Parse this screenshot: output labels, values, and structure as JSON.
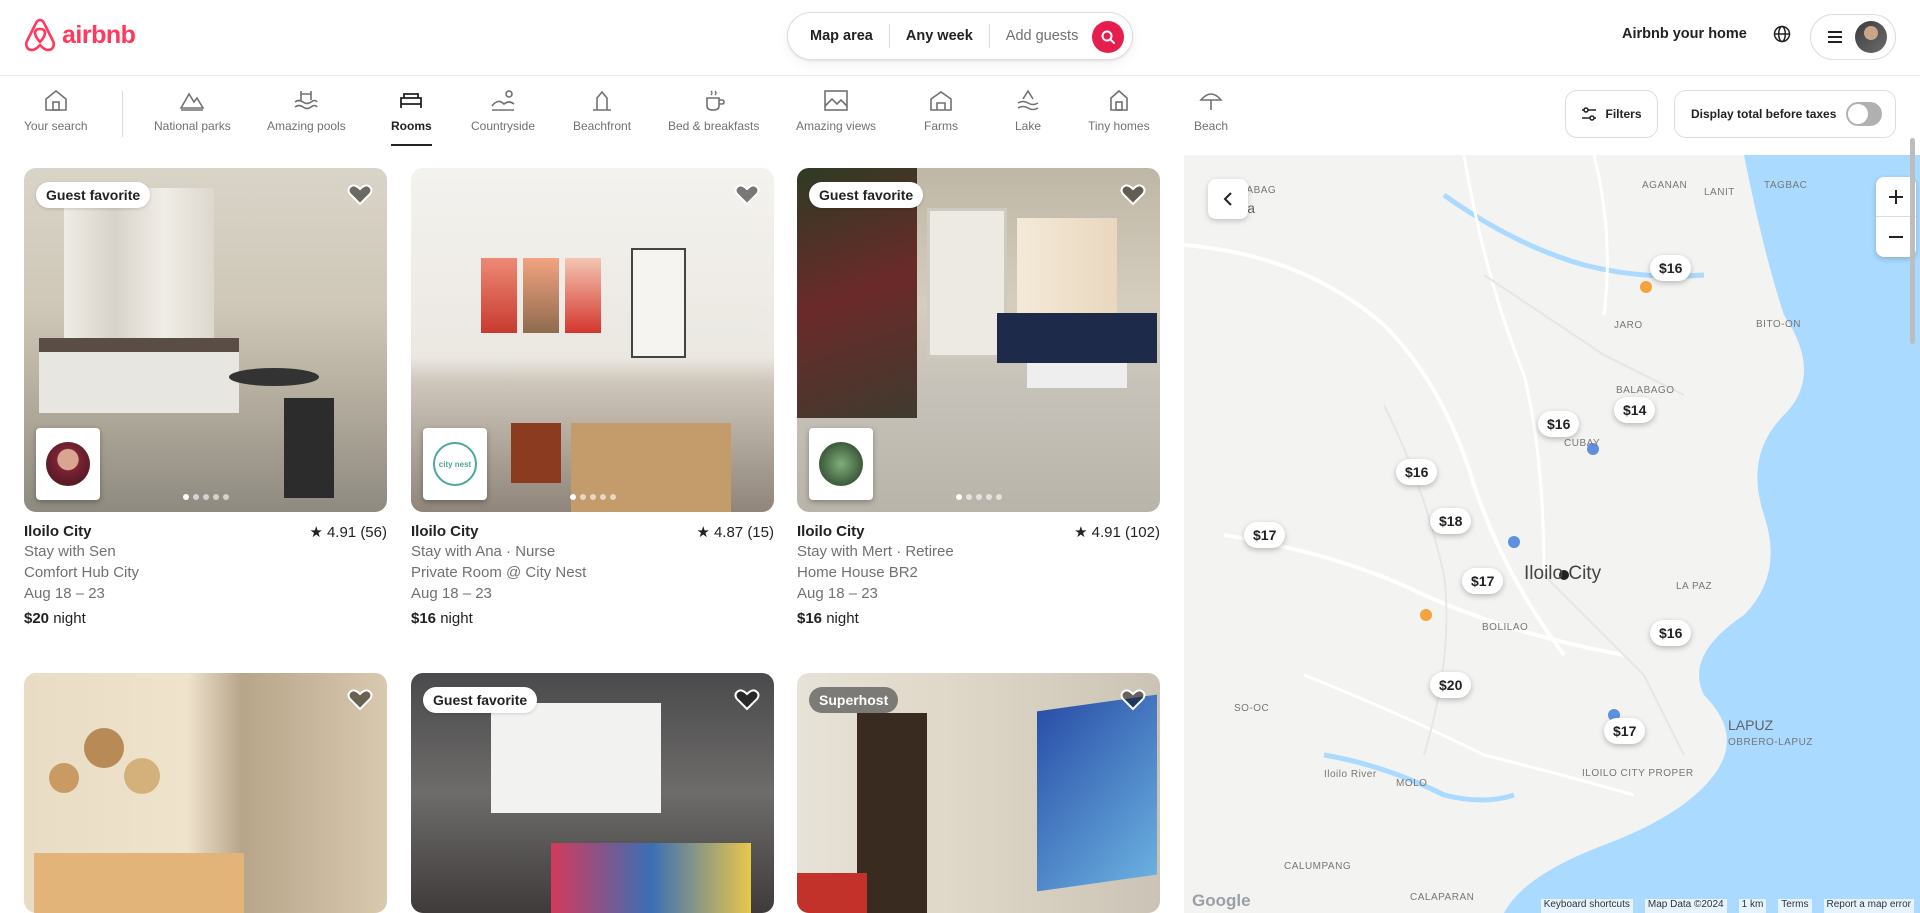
{
  "header": {
    "logo_text": "airbnb",
    "search": {
      "location": "Map area",
      "dates": "Any week",
      "guests": "Add guests"
    },
    "host_link": "Airbnb your home",
    "icons": {
      "search": "search-icon",
      "globe": "globe-icon",
      "menu": "menu-icon"
    },
    "brand_color": "#ff385c"
  },
  "categories": {
    "items": [
      {
        "label": "Your search",
        "icon": "search-history-icon"
      },
      {
        "label": "National parks",
        "icon": "national-park-icon"
      },
      {
        "label": "Amazing pools",
        "icon": "pool-icon"
      },
      {
        "label": "Rooms",
        "icon": "room-icon",
        "active": true
      },
      {
        "label": "Countryside",
        "icon": "countryside-icon"
      },
      {
        "label": "Beachfront",
        "icon": "beachfront-icon"
      },
      {
        "label": "Bed & breakfasts",
        "icon": "breakfast-icon"
      },
      {
        "label": "Amazing views",
        "icon": "views-icon"
      },
      {
        "label": "Farms",
        "icon": "farm-icon"
      },
      {
        "label": "Lake",
        "icon": "lake-icon"
      },
      {
        "label": "Tiny homes",
        "icon": "tiny-home-icon"
      },
      {
        "label": "Beach",
        "icon": "beach-icon"
      }
    ],
    "filters_label": "Filters",
    "tax_toggle_label": "Display total before taxes"
  },
  "listings": [
    {
      "badge": "Guest favorite",
      "location": "Iloilo City",
      "rating": "4.91 (56)",
      "line1": "Stay with Sen",
      "line2": "Comfort Hub City",
      "dates": "Aug 18 – 23",
      "price": "$20",
      "price_unit": "night"
    },
    {
      "badge": "",
      "location": "Iloilo City",
      "rating": "4.87 (15)",
      "line1": "Stay with Ana · Nurse",
      "line2": "Private Room @ City Nest",
      "dates": "Aug 18 – 23",
      "price": "$16",
      "price_unit": "night",
      "host_logo_text": "city nest"
    },
    {
      "badge": "Guest favorite",
      "location": "Iloilo City",
      "rating": "4.91 (102)",
      "line1": "Stay with Mert · Retiree",
      "line2": "Home House BR2",
      "dates": "Aug 18 – 23",
      "price": "$16",
      "price_unit": "night"
    },
    {
      "badge": ""
    },
    {
      "badge": "Guest favorite"
    },
    {
      "badge": "Superhost"
    }
  ],
  "map": {
    "pins": [
      "$16",
      "$14",
      "$16",
      "$16",
      "$18",
      "$17",
      "$17",
      "$16",
      "$20",
      "$17"
    ],
    "labels": {
      "lanit": "LANIT",
      "tagbac": "TAGBAC",
      "agganon": "AGANAN",
      "balabag": "BALABAG",
      "pavia": "Pavia",
      "jaro": "JARO",
      "bito_on": "BITO-ON",
      "balabago": "BALABAGO",
      "cubay": "CUBAY",
      "iloilo": "Iloilo City",
      "la_paz": "LA PAZ",
      "bolilao": "BOLILAO",
      "so_oc": "SO-OC",
      "lapuz": "LAPUZ",
      "obrero": "OBRERO-LAPUZ",
      "proper": "ILOILO CITY PROPER",
      "molo": "MOLO",
      "calumpang": "CALUMPANG",
      "calaparan": "CALAPARAN",
      "river": "Iloilo River"
    },
    "footer": [
      "Keyboard shortcuts",
      "Map Data ©2024",
      "1 km",
      "Terms",
      "Report a map error"
    ],
    "google": "Google"
  }
}
